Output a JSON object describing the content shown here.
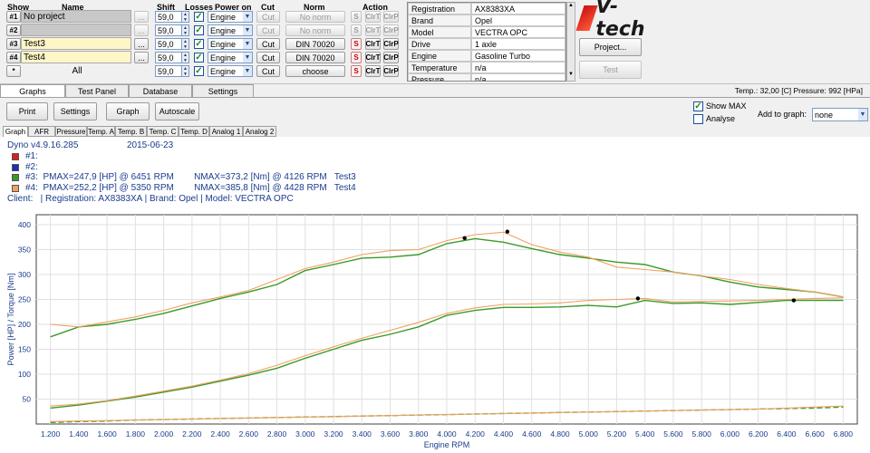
{
  "header_row": {
    "show": "Show",
    "name": "Name",
    "shift": "Shift",
    "losses": "Losses",
    "power_on": "Power on",
    "cut": "Cut",
    "norm": "Norm",
    "action": "Action"
  },
  "rows": [
    {
      "num": "#1",
      "name": "No project",
      "dots": "...",
      "shift": "59,0",
      "power": "Engine",
      "cut": "Cut",
      "norm": "No norm",
      "s": "S",
      "clrt": "ClrT",
      "clrp": "ClrP",
      "active": false
    },
    {
      "num": "#2",
      "name": "",
      "dots": "...",
      "shift": "59,0",
      "power": "Engine",
      "cut": "Cut",
      "norm": "No norm",
      "s": "S",
      "clrt": "ClrT",
      "clrp": "ClrP",
      "active": false
    },
    {
      "num": "#3",
      "name": "Test3",
      "dots": "...",
      "shift": "59,0",
      "power": "Engine",
      "cut": "Cut",
      "norm": "DIN 70020",
      "s": "S",
      "clrt": "ClrT",
      "clrp": "ClrP",
      "active": true
    },
    {
      "num": "#4",
      "name": "Test4",
      "dots": "...",
      "shift": "59,0",
      "power": "Engine",
      "cut": "Cut",
      "norm": "DIN 70020",
      "s": "S",
      "clrt": "ClrT",
      "clrp": "ClrP",
      "active": true
    },
    {
      "num": "*",
      "name": "All",
      "dots": "",
      "shift": "59,0",
      "power": "Engine",
      "cut": "Cut",
      "norm": "choose",
      "s": "S",
      "clrt": "ClrT",
      "clrp": "ClrP",
      "active": true
    }
  ],
  "info_grid": [
    {
      "label": "Registration",
      "value": "AX8383XA"
    },
    {
      "label": "Brand",
      "value": "Opel"
    },
    {
      "label": "Model",
      "value": "VECTRA OPC"
    },
    {
      "label": "Drive",
      "value": "1 axle"
    },
    {
      "label": "Engine",
      "value": "Gasoline Turbo"
    },
    {
      "label": "Temperature",
      "value": "n/a"
    },
    {
      "label": "Pressure",
      "value": "n/a"
    }
  ],
  "logo": "V-tech",
  "project_button": "Project...",
  "test_button": "Test",
  "main_tabs": [
    "Graphs",
    "Test Panel",
    "Database",
    "Settings"
  ],
  "status": "Temp.: 32,00 [C]  Pressure: 992 [HPa]",
  "toolbar": {
    "print": "Print",
    "settings": "Settings",
    "graph": "Graph",
    "autoscale": "Autoscale",
    "show_max": "Show MAX",
    "analyse": "Analyse",
    "add_to_graph": "Add to graph:",
    "add_to_graph_value": "none"
  },
  "sub_tabs": [
    "Graph",
    "AFR",
    "Pressure",
    "Temp. A",
    "Temp. B",
    "Temp. C",
    "Temp. D",
    "Analog 1",
    "Analog 2"
  ],
  "legend": {
    "version": "Dyno v4.9.16.285",
    "date": "2015-06-23",
    "lines": [
      {
        "label": "#1:",
        "color": "#d42020"
      },
      {
        "label": "#2:",
        "color": "#1c2fb8"
      },
      {
        "label": "#3:  PMAX=247,9 [HP] @ 6451 RPM        NMAX=373,2 [Nm] @ 4126 RPM   Test3",
        "color": "#3a9a2a"
      },
      {
        "label": "#4:  PMAX=252,2 [HP] @ 5350 RPM        NMAX=385,8 [Nm] @ 4428 RPM   Test4",
        "color": "#f0a060"
      }
    ],
    "client": "Client:   | Registration: AX8383XA | Brand: Opel | Model: VECTRA OPC"
  },
  "chart_data": {
    "type": "line",
    "xlabel": "Engine RPM",
    "ylabel": "Power [HP] / Torque [Nm]",
    "xlim": [
      1100,
      6900
    ],
    "ylim": [
      0,
      420
    ],
    "x_ticks": [
      "1.200",
      "1.400",
      "1.600",
      "1.800",
      "2.000",
      "2.200",
      "2.400",
      "2.600",
      "2.800",
      "3.000",
      "3.200",
      "3.400",
      "3.600",
      "3.800",
      "4.000",
      "4.200",
      "4.400",
      "4.600",
      "4.800",
      "5.000",
      "5.200",
      "5.400",
      "5.600",
      "5.800",
      "6.000",
      "6.200",
      "6.400",
      "6.600",
      "6.800"
    ],
    "y_ticks": [
      50,
      100,
      150,
      200,
      250,
      300,
      350,
      400
    ],
    "x": [
      1200,
      1400,
      1600,
      1800,
      2000,
      2200,
      2400,
      2600,
      2800,
      3000,
      3200,
      3400,
      3600,
      3800,
      4000,
      4200,
      4400,
      4600,
      4800,
      5000,
      5200,
      5400,
      5600,
      5800,
      6000,
      6200,
      6400,
      6600,
      6800
    ],
    "series": [
      {
        "name": "Test3",
        "kind": "torque",
        "color": "#3a9a2a",
        "values": [
          175,
          195,
          200,
          210,
          222,
          237,
          252,
          265,
          280,
          308,
          320,
          333,
          335,
          340,
          362,
          372,
          365,
          352,
          340,
          333,
          325,
          320,
          305,
          297,
          285,
          275,
          270,
          265,
          255
        ]
      },
      {
        "name": "Test4",
        "kind": "torque",
        "color": "#f0a060",
        "values": [
          200,
          195,
          205,
          215,
          228,
          243,
          255,
          268,
          290,
          312,
          325,
          340,
          348,
          350,
          368,
          380,
          385,
          360,
          345,
          335,
          315,
          310,
          305,
          297,
          290,
          280,
          272,
          265,
          255
        ]
      },
      {
        "name": "Test3",
        "kind": "power",
        "color": "#3a9a2a",
        "values": [
          32,
          38,
          46,
          54,
          64,
          74,
          86,
          98,
          112,
          132,
          150,
          168,
          180,
          195,
          218,
          228,
          234,
          234,
          235,
          238,
          235,
          248,
          242,
          243,
          240,
          244,
          248,
          248,
          248
        ]
      },
      {
        "name": "Test4",
        "kind": "power",
        "color": "#f0a060",
        "values": [
          36,
          40,
          47,
          56,
          66,
          76,
          88,
          101,
          118,
          137,
          155,
          172,
          188,
          204,
          222,
          233,
          240,
          241,
          243,
          248,
          250,
          252,
          245,
          246,
          247,
          248,
          250,
          252,
          253
        ]
      },
      {
        "name": "Test3",
        "kind": "aux",
        "color": "#3a9a2a",
        "values": [
          3,
          5,
          6,
          8,
          9,
          10,
          11,
          12,
          13,
          14,
          15,
          16,
          17,
          18,
          19,
          20,
          21,
          22,
          23,
          24,
          25,
          26,
          27,
          28,
          29,
          30,
          31,
          32,
          34
        ]
      },
      {
        "name": "Test4",
        "kind": "aux",
        "color": "#f0a060",
        "values": [
          5,
          6,
          7,
          8,
          9,
          10,
          11,
          12,
          13,
          14,
          15,
          16,
          17,
          18,
          19,
          20,
          21,
          22,
          23,
          24,
          25,
          26,
          27,
          28,
          29,
          30,
          32,
          34,
          36
        ]
      }
    ],
    "max_points": [
      {
        "x": 4126,
        "y": 373
      },
      {
        "x": 4428,
        "y": 386
      },
      {
        "x": 5350,
        "y": 252
      },
      {
        "x": 6451,
        "y": 248
      }
    ],
    "grid": true
  }
}
